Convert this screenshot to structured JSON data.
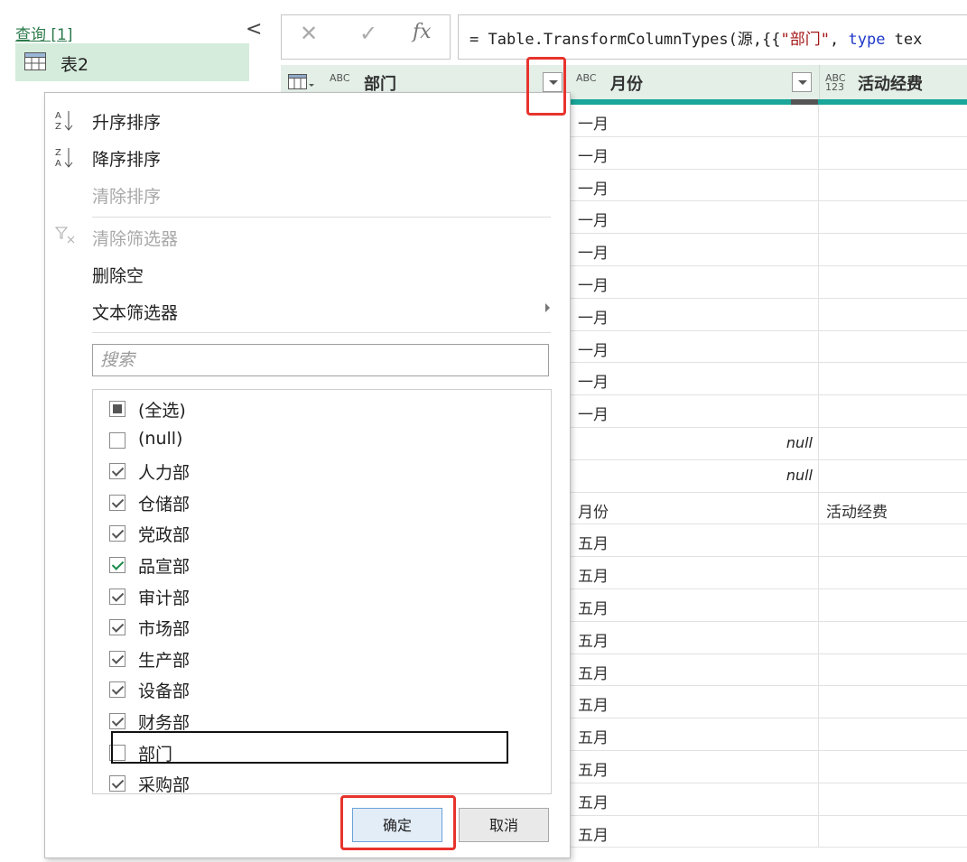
{
  "queries": {
    "title": "查询 [1]",
    "collapse": "<",
    "items": [
      {
        "label": "表2"
      }
    ]
  },
  "formula_bar": {
    "cancel_icon": "✕",
    "confirm_icon": "✓",
    "fx_label": "fx",
    "formula": {
      "prefix": "= Table.TransformColumnTypes(源,{{",
      "string1": "\"部门\"",
      "sep": ", ",
      "keyword": "type",
      "suffix": " tex"
    }
  },
  "grid": {
    "columns": [
      {
        "type_icon": "ABC",
        "title": "部门"
      },
      {
        "type_icon": "ABC",
        "title": "月份"
      },
      {
        "type_icon": "ABC 123",
        "title": "活动经费"
      }
    ],
    "rows": [
      {
        "month": "一月",
        "fee": ""
      },
      {
        "month": "一月",
        "fee": ""
      },
      {
        "month": "一月",
        "fee": ""
      },
      {
        "month": "一月",
        "fee": ""
      },
      {
        "month": "一月",
        "fee": ""
      },
      {
        "month": "一月",
        "fee": ""
      },
      {
        "month": "一月",
        "fee": ""
      },
      {
        "month": "一月",
        "fee": ""
      },
      {
        "month": "一月",
        "fee": ""
      },
      {
        "month": "一月",
        "fee": ""
      },
      {
        "month": "null",
        "fee": ""
      },
      {
        "month": "null",
        "fee": ""
      },
      {
        "month": "月份",
        "fee": "活动经费"
      },
      {
        "month": "五月",
        "fee": ""
      },
      {
        "month": "五月",
        "fee": ""
      },
      {
        "month": "五月",
        "fee": ""
      },
      {
        "month": "五月",
        "fee": ""
      },
      {
        "month": "五月",
        "fee": ""
      },
      {
        "month": "五月",
        "fee": ""
      },
      {
        "month": "五月",
        "fee": ""
      },
      {
        "month": "五月",
        "fee": ""
      },
      {
        "month": "五月",
        "fee": ""
      },
      {
        "month": "五月",
        "fee": ""
      }
    ]
  },
  "filter_menu": {
    "sort_asc": "升序排序",
    "sort_desc": "降序排序",
    "clear_sort": "清除排序",
    "clear_filter": "清除筛选器",
    "remove_empty": "删除空",
    "text_filters": "文本筛选器",
    "search_placeholder": "搜索",
    "items": [
      {
        "label": "(全选)",
        "state": "indeterminate"
      },
      {
        "label": "(null)",
        "state": "unchecked"
      },
      {
        "label": "人力部",
        "state": "checked"
      },
      {
        "label": "仓储部",
        "state": "checked"
      },
      {
        "label": "党政部",
        "state": "checked"
      },
      {
        "label": "品宣部",
        "state": "checked"
      },
      {
        "label": "审计部",
        "state": "checked"
      },
      {
        "label": "市场部",
        "state": "checked"
      },
      {
        "label": "生产部",
        "state": "checked"
      },
      {
        "label": "设备部",
        "state": "checked"
      },
      {
        "label": "财务部",
        "state": "checked"
      },
      {
        "label": "部门",
        "state": "unchecked"
      },
      {
        "label": "采购部",
        "state": "checked"
      }
    ],
    "ok_label": "确定",
    "cancel_label": "取消"
  },
  "colors": {
    "accent_green": "#d5ecdc",
    "column_quality_bar": "#1aa69a",
    "highlight_red": "#e8332d"
  }
}
